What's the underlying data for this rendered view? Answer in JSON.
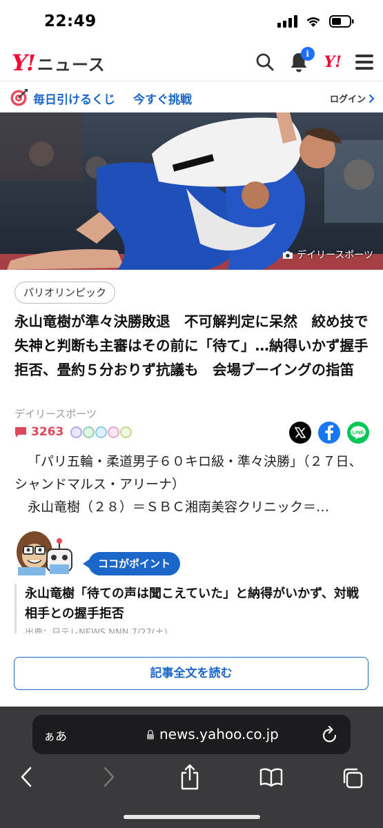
{
  "status_bar": {
    "time": "22:49"
  },
  "header": {
    "logo_y": "Y!",
    "logo_news": "ニュース",
    "notification_badge": "i",
    "yahoo_mini": "Y!"
  },
  "lottery_bar": {
    "text1": "毎日引けるくじ",
    "text2": "今すぐ挑戦",
    "login": "ログイン"
  },
  "photo": {
    "credit": "デイリースポーツ"
  },
  "article": {
    "tag": "パリオリンピック",
    "headline": "永山竜樹が準々決勝敗退　不可解判定に呆然　絞め技で失神と判断も主審はその前に「待て」…納得いかず握手拒否、畳約５分おりず抗議も　会場ブーイングの指笛",
    "source": "デイリースポーツ",
    "comment_count": "3263",
    "body_line1": "「パリ五輪・柔道男子６０キロ級・準々決勝」（２７日、シャンドマルス・アリーナ）",
    "body_line2": "永山竜樹（２８）＝ＳＢＣ湘南美容クリニック＝…"
  },
  "point": {
    "label": "ココがポイント",
    "title": "永山竜樹「待ての声は聞こえていた」と納得がいかず、対戦相手との握手拒否",
    "source": "出典：日テレNEWS NNN 7/27(土)"
  },
  "read_button": "記事全文を読む",
  "browser": {
    "aa": "ぁあ",
    "url": "news.yahoo.co.jp"
  },
  "colors": {
    "brand_red": "#ff0033",
    "link_blue": "#1b66c9",
    "comment_red": "#e0465b"
  }
}
